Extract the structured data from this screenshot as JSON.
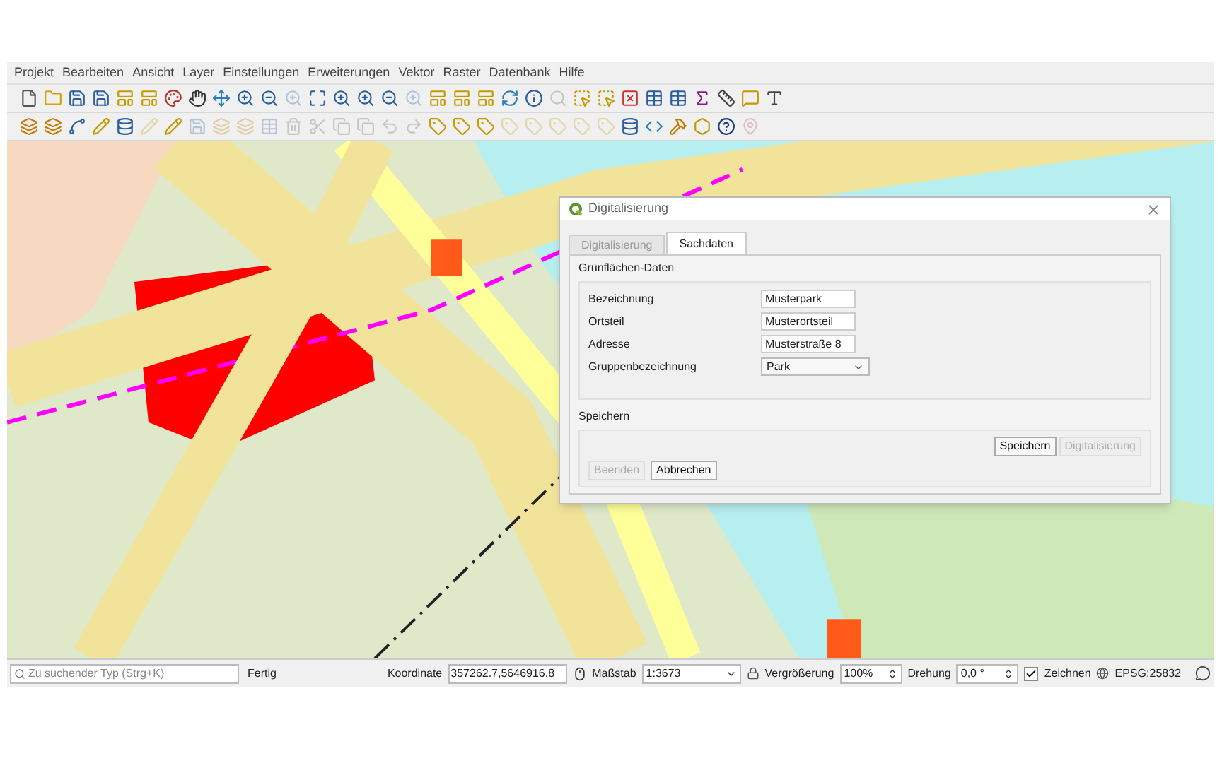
{
  "menu": [
    "Projekt",
    "Bearbeiten",
    "Ansicht",
    "Layer",
    "Einstellungen",
    "Erweiterungen",
    "Vektor",
    "Raster",
    "Datenbank",
    "Hilfe"
  ],
  "toolbar_1": [
    {
      "kind": "new",
      "disabled": false
    },
    {
      "kind": "open",
      "disabled": false
    },
    {
      "kind": "save",
      "disabled": false
    },
    {
      "kind": "save",
      "disabled": false
    },
    {
      "kind": "layout",
      "disabled": false
    },
    {
      "kind": "layout",
      "disabled": false
    },
    {
      "kind": "style",
      "disabled": false
    },
    {
      "kind": "pan",
      "disabled": false
    },
    {
      "kind": "move",
      "disabled": false
    },
    {
      "kind": "zoom-in",
      "disabled": false
    },
    {
      "kind": "zoom-out",
      "disabled": false
    },
    {
      "kind": "zoom-in",
      "disabled": true
    },
    {
      "kind": "extent",
      "disabled": false
    },
    {
      "kind": "zoom-in",
      "disabled": false
    },
    {
      "kind": "zoom-in",
      "disabled": false
    },
    {
      "kind": "zoom-out",
      "disabled": false
    },
    {
      "kind": "zoom-in",
      "disabled": true
    },
    {
      "kind": "layout",
      "disabled": false
    },
    {
      "kind": "layout",
      "disabled": false
    },
    {
      "kind": "layout",
      "disabled": false
    },
    {
      "kind": "refresh",
      "disabled": false
    },
    {
      "kind": "info",
      "disabled": false
    },
    {
      "kind": "search",
      "disabled": true
    },
    {
      "kind": "select",
      "disabled": false
    },
    {
      "kind": "select",
      "disabled": false
    },
    {
      "kind": "deselect",
      "disabled": false
    },
    {
      "kind": "table",
      "disabled": false
    },
    {
      "kind": "table",
      "disabled": false
    },
    {
      "kind": "sigma",
      "disabled": false
    },
    {
      "kind": "ruler",
      "disabled": false
    },
    {
      "kind": "tip",
      "disabled": false
    },
    {
      "kind": "text",
      "disabled": false
    }
  ],
  "toolbar_2": [
    {
      "kind": "layers",
      "disabled": false
    },
    {
      "kind": "layers",
      "disabled": false
    },
    {
      "kind": "vector",
      "disabled": false
    },
    {
      "kind": "pencil",
      "disabled": false
    },
    {
      "kind": "database",
      "disabled": false
    },
    {
      "kind": "pencil",
      "disabled": true
    },
    {
      "kind": "pencil",
      "disabled": false
    },
    {
      "kind": "save",
      "disabled": true
    },
    {
      "kind": "layers",
      "disabled": true
    },
    {
      "kind": "layers",
      "disabled": true
    },
    {
      "kind": "table",
      "disabled": true
    },
    {
      "kind": "trash",
      "disabled": true
    },
    {
      "kind": "scissors",
      "disabled": true
    },
    {
      "kind": "copy",
      "disabled": true
    },
    {
      "kind": "copy",
      "disabled": true
    },
    {
      "kind": "undo",
      "disabled": true
    },
    {
      "kind": "redo",
      "disabled": true
    },
    {
      "kind": "tag",
      "disabled": false
    },
    {
      "kind": "tag",
      "disabled": false
    },
    {
      "kind": "tag",
      "disabled": false
    },
    {
      "kind": "tag",
      "disabled": true
    },
    {
      "kind": "tag",
      "disabled": true
    },
    {
      "kind": "tag",
      "disabled": true
    },
    {
      "kind": "tag",
      "disabled": true
    },
    {
      "kind": "tag",
      "disabled": true
    },
    {
      "kind": "database",
      "disabled": false
    },
    {
      "kind": "code",
      "disabled": false
    },
    {
      "kind": "hammer",
      "disabled": false
    },
    {
      "kind": "polygon",
      "disabled": false
    },
    {
      "kind": "help",
      "disabled": false
    },
    {
      "kind": "pin",
      "disabled": true
    }
  ],
  "dialog": {
    "title": "Digitalisierung",
    "tabs": [
      {
        "label": "Digitalisierung",
        "selected": false
      },
      {
        "label": "Sachdaten",
        "selected": true
      }
    ],
    "group_1": {
      "title": "Grünflächen-Daten",
      "fields": [
        {
          "kind": "text",
          "label": "Bezeichnung",
          "value": "Musterpark"
        },
        {
          "kind": "text",
          "label": "Ortsteil",
          "value": "Musterortsteil"
        },
        {
          "kind": "text",
          "label": "Adresse",
          "value": "Musterstraße 8"
        },
        {
          "kind": "select",
          "label": "Gruppenbezeichnung",
          "value": "Park"
        }
      ]
    },
    "group_2": {
      "title": "Speichern",
      "buttons_top": [
        {
          "label": "Speichern",
          "disabled": false
        },
        {
          "label": "Digitalisierung",
          "disabled": true
        }
      ],
      "buttons_bottom": [
        {
          "label": "Beenden",
          "disabled": true
        },
        {
          "label": "Abbrechen",
          "disabled": false
        }
      ]
    }
  },
  "status_bar": {
    "search_placeholder": "Zu suchender Typ (Strg+K)",
    "message": "Fertig",
    "coordinate_label": "Koordinate",
    "coordinate": "357262.7,5646916.8",
    "scale_label": "Maßstab",
    "scale": "1:3673",
    "magnifier_label": "Vergrößerung",
    "magnifier": "100%",
    "rotation_label": "Drehung",
    "rotation": "0,0 °",
    "render": {
      "label": "Zeichnen",
      "checked": true
    },
    "crs": "EPSG:25832"
  }
}
